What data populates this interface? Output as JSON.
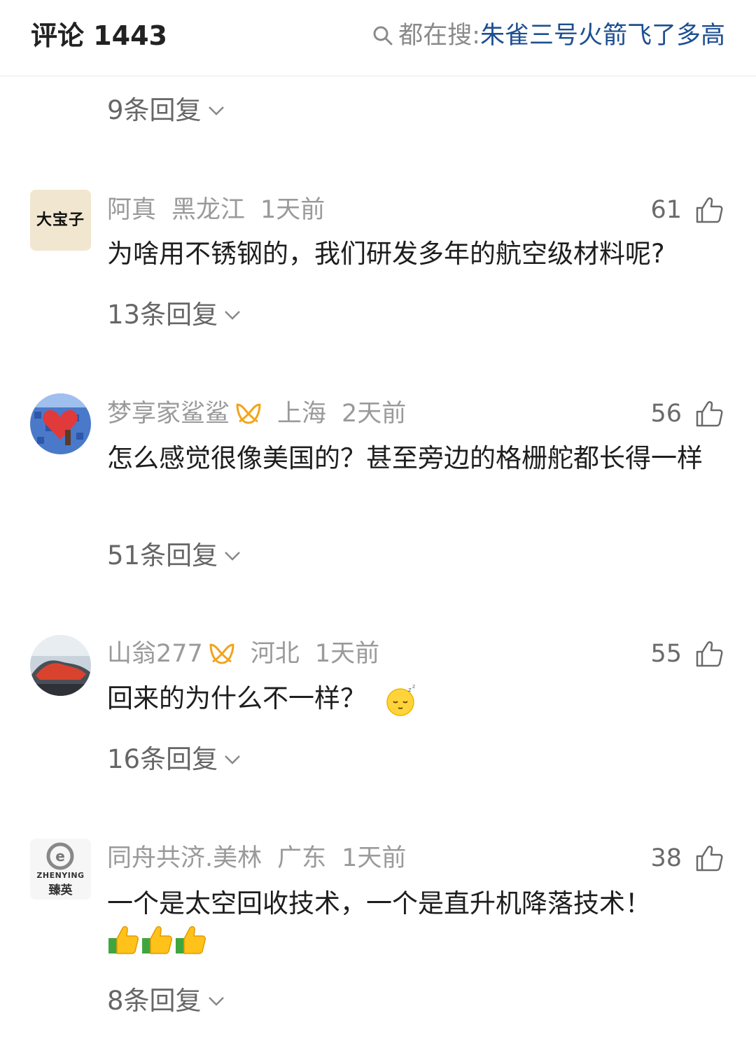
{
  "header": {
    "title": "评论 1443",
    "search_label": "都在搜:",
    "search_query": "朱雀三号火箭飞了多高"
  },
  "top_replies": "9条回复",
  "comments": [
    {
      "user": "阿真",
      "location": "黑龙江",
      "time": "1天前",
      "likes": "61",
      "text": "为啥用不锈钢的，我们研发多年的航空级材料呢?",
      "replies": "13条回复",
      "avatar_text": "大宝子"
    },
    {
      "user": "梦享家鲨鲨",
      "location": "上海",
      "time": "2天前",
      "likes": "56",
      "text": "怎么感觉很像美国的？甚至旁边的格栅舵都长得一样",
      "replies": "51条回复"
    },
    {
      "user": "山翁277",
      "location": "河北",
      "time": "1天前",
      "likes": "55",
      "text": "回来的为什么不一样？",
      "replies": "16条回复"
    },
    {
      "user": "同舟共济.美林",
      "location": "广东",
      "time": "1天前",
      "likes": "38",
      "text": "一个是太空回收技术，一个是直升机降落技术！",
      "replies": "8条回复",
      "avatar_text_top": "ZHENYING",
      "avatar_text_bottom": "臻英"
    }
  ],
  "icons": {
    "search": "search-icon",
    "like": "thumbs-up-icon",
    "badge": "vip-badge-icon",
    "chevron": "chevron-down-icon",
    "emoji_sleepy": "sleepy-face-emoji",
    "emoji_thumbs": "thumbs-up-emoji"
  }
}
